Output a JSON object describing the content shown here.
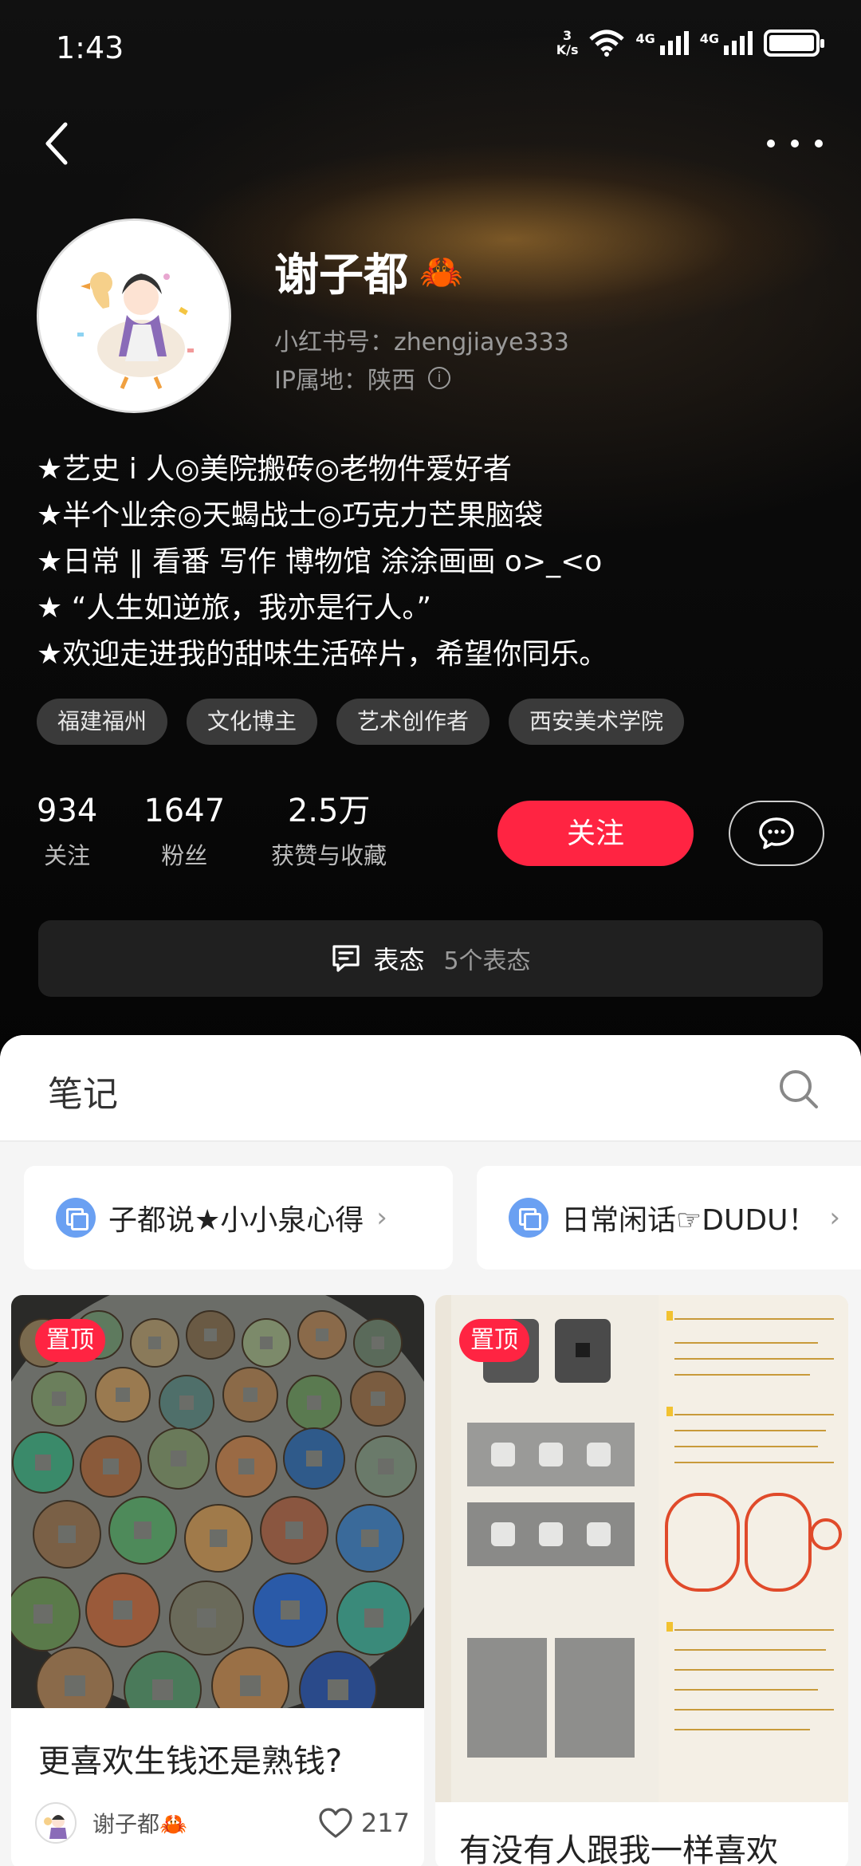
{
  "status_bar": {
    "time": "1:43",
    "net_speed_value": "3",
    "net_speed_unit": "K/s",
    "signal1_label": "4G",
    "signal2_label": "4G"
  },
  "profile": {
    "nickname": "谢子都",
    "nickname_emoji": "🦀",
    "account_id": "小红书号：zhengjiaye333",
    "ip_location": "IP属地：陕西",
    "bio": [
      "★艺史 i 人◎美院搬砖◎老物件爱好者",
      "★半个业余◎天蝎战士◎巧克力芒果脑袋",
      "★日常 ‖ 看番 写作 博物馆 涂涂画画 o>_<o",
      "★ “人生如逆旅，我亦是行人。”",
      "★欢迎走进我的甜味生活碎片，希望你同乐。"
    ],
    "tags": [
      "福建福州",
      "文化博主",
      "艺术创作者",
      "西安美术学院"
    ]
  },
  "stats": [
    {
      "value": "934",
      "label": "关注"
    },
    {
      "value": "1647",
      "label": "粉丝"
    },
    {
      "value": "2.5万",
      "label": "获赞与收藏"
    }
  ],
  "actions": {
    "follow_label": "关注"
  },
  "status_entry": {
    "label": "表态",
    "count": "5个表态"
  },
  "notes_section": {
    "title": "笔记"
  },
  "collections": [
    {
      "label": "子都说★小小泉心得"
    },
    {
      "label": "日常闲话☞DUDU！"
    }
  ],
  "cards": [
    {
      "pin": "置顶",
      "title": "更喜欢生钱还是熟钱?",
      "author": "谢子都🦀",
      "likes": "217"
    },
    {
      "pin": "置顶",
      "title": "有没有人跟我一样喜欢"
    }
  ],
  "colors": {
    "accent": "#ff2442",
    "collection_icon": "#6aa0f2"
  }
}
